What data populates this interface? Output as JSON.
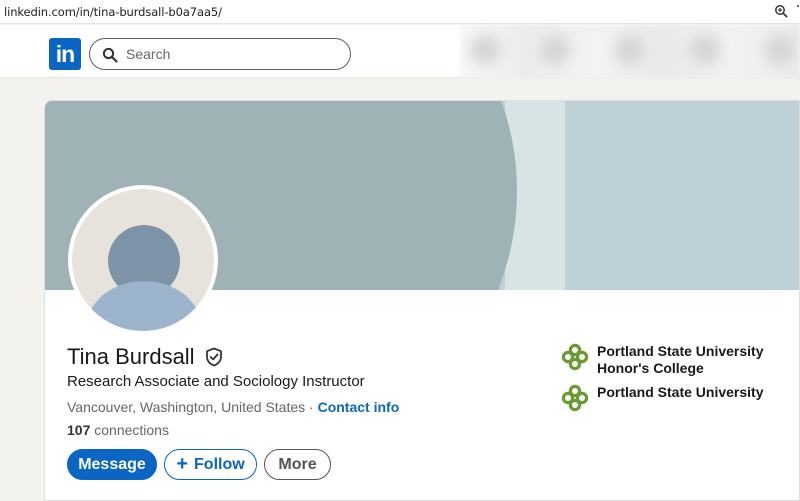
{
  "browser": {
    "url": "linkedin.com/in/tina-burdsall-b0a7aa5/"
  },
  "nav": {
    "logo_text": "in",
    "search_placeholder": "Search"
  },
  "profile": {
    "name": "Tina Burdsall",
    "headline": "Research Associate and Sociology Instructor",
    "location": "Vancouver, Washington, United States",
    "separator": "·",
    "contact_info": "Contact info",
    "connections_count": "107",
    "connections_label": "connections",
    "actions": {
      "message": "Message",
      "follow_plus": "+",
      "follow": "Follow",
      "more": "More"
    },
    "education": [
      {
        "line1": "Portland State University",
        "line2": "Honor's College"
      },
      {
        "line1": "Portland State University",
        "line2": ""
      }
    ]
  },
  "colors": {
    "brand": "#0a66c2",
    "cover_light": "#bdd1d7",
    "cover_dark": "#9fb2b5",
    "edu_icon": "#6a9a32"
  }
}
